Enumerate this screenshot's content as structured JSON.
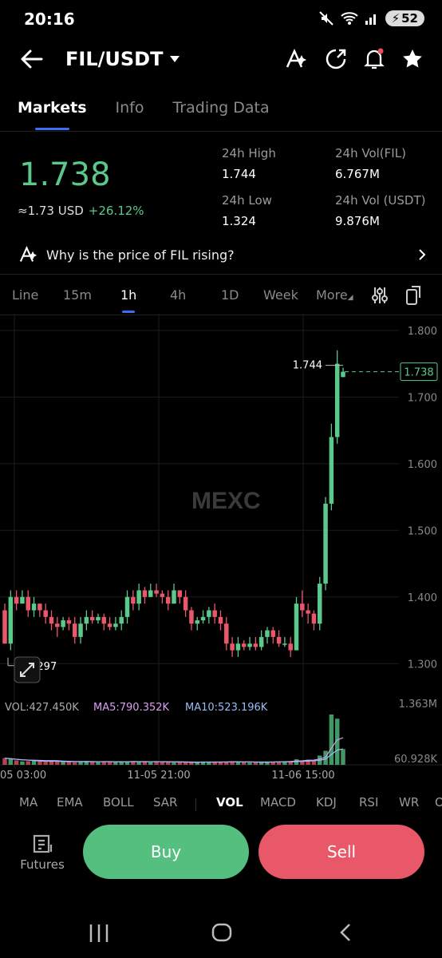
{
  "status": {
    "time": "20:16",
    "battery": "52"
  },
  "header": {
    "pair": "FIL/USDT"
  },
  "tabs": [
    {
      "label": "Markets",
      "active": true
    },
    {
      "label": "Info",
      "active": false
    },
    {
      "label": "Trading Data",
      "active": false
    }
  ],
  "price": {
    "last": "1.738",
    "usd": "≈1.73 USD",
    "change": "+26.12%",
    "stats": {
      "high_label": "24h High",
      "high": "1.744",
      "low_label": "24h Low",
      "low": "1.324",
      "vol_fil_label": "24h Vol(FIL)",
      "vol_fil": "6.767M",
      "vol_usdt_label": "24h Vol (USDT)",
      "vol_usdt": "9.876M"
    }
  },
  "why": {
    "text": "Why is the price of FIL rising?"
  },
  "intervals": [
    "Line",
    "15m",
    "1h",
    "4h",
    "1D",
    "Week",
    "More"
  ],
  "active_interval": "1h",
  "chart_data": {
    "type": "candlestick",
    "watermark": "MEXC",
    "y_ticks": [
      "1.800",
      "1.700",
      "1.600",
      "1.500",
      "1.400",
      "1.300"
    ],
    "ylim": [
      1.25,
      1.825
    ],
    "x_ticks": [
      "05 03:00",
      "11-05 21:00",
      "11-06 15:00"
    ],
    "last_price_tag": "1.738",
    "last_price": 1.738,
    "high_marker": "1.744",
    "high_value": 1.744,
    "low_marker": "1.297",
    "low_value": 1.297,
    "candles": [
      [
        1.38,
        1.33,
        1.39,
        1.33
      ],
      [
        1.33,
        1.4,
        1.41,
        1.32
      ],
      [
        1.4,
        1.39,
        1.41,
        1.38
      ],
      [
        1.39,
        1.4,
        1.41,
        1.39
      ],
      [
        1.4,
        1.38,
        1.41,
        1.37
      ],
      [
        1.38,
        1.39,
        1.4,
        1.37
      ],
      [
        1.39,
        1.38,
        1.39,
        1.37
      ],
      [
        1.38,
        1.37,
        1.39,
        1.36
      ],
      [
        1.37,
        1.36,
        1.38,
        1.35
      ],
      [
        1.36,
        1.355,
        1.37,
        1.34
      ],
      [
        1.355,
        1.365,
        1.37,
        1.35
      ],
      [
        1.365,
        1.36,
        1.37,
        1.35
      ],
      [
        1.36,
        1.34,
        1.37,
        1.33
      ],
      [
        1.34,
        1.36,
        1.37,
        1.33
      ],
      [
        1.36,
        1.37,
        1.38,
        1.35
      ],
      [
        1.37,
        1.365,
        1.38,
        1.36
      ],
      [
        1.365,
        1.37,
        1.375,
        1.36
      ],
      [
        1.37,
        1.36,
        1.375,
        1.35
      ],
      [
        1.36,
        1.355,
        1.37,
        1.35
      ],
      [
        1.355,
        1.36,
        1.37,
        1.35
      ],
      [
        1.36,
        1.37,
        1.38,
        1.35
      ],
      [
        1.37,
        1.4,
        1.41,
        1.36
      ],
      [
        1.4,
        1.39,
        1.41,
        1.38
      ],
      [
        1.39,
        1.41,
        1.42,
        1.38
      ],
      [
        1.41,
        1.4,
        1.415,
        1.39
      ],
      [
        1.4,
        1.41,
        1.42,
        1.4
      ],
      [
        1.41,
        1.405,
        1.42,
        1.4
      ],
      [
        1.405,
        1.4,
        1.41,
        1.39
      ],
      [
        1.4,
        1.39,
        1.41,
        1.38
      ],
      [
        1.39,
        1.41,
        1.42,
        1.39
      ],
      [
        1.41,
        1.4,
        1.41,
        1.39
      ],
      [
        1.4,
        1.38,
        1.41,
        1.37
      ],
      [
        1.38,
        1.36,
        1.385,
        1.35
      ],
      [
        1.36,
        1.365,
        1.37,
        1.35
      ],
      [
        1.365,
        1.37,
        1.38,
        1.36
      ],
      [
        1.37,
        1.38,
        1.385,
        1.36
      ],
      [
        1.38,
        1.37,
        1.39,
        1.36
      ],
      [
        1.37,
        1.36,
        1.38,
        1.35
      ],
      [
        1.36,
        1.33,
        1.37,
        1.32
      ],
      [
        1.33,
        1.32,
        1.34,
        1.31
      ],
      [
        1.32,
        1.33,
        1.34,
        1.31
      ],
      [
        1.33,
        1.325,
        1.335,
        1.32
      ],
      [
        1.325,
        1.33,
        1.34,
        1.32
      ],
      [
        1.33,
        1.325,
        1.34,
        1.32
      ],
      [
        1.325,
        1.34,
        1.35,
        1.32
      ],
      [
        1.34,
        1.35,
        1.355,
        1.33
      ],
      [
        1.35,
        1.34,
        1.355,
        1.33
      ],
      [
        1.34,
        1.33,
        1.35,
        1.325
      ],
      [
        1.33,
        1.33,
        1.34,
        1.325
      ],
      [
        1.33,
        1.32,
        1.34,
        1.31
      ],
      [
        1.32,
        1.39,
        1.4,
        1.32
      ],
      [
        1.39,
        1.38,
        1.41,
        1.37
      ],
      [
        1.38,
        1.375,
        1.39,
        1.36
      ],
      [
        1.375,
        1.36,
        1.38,
        1.35
      ],
      [
        1.36,
        1.42,
        1.43,
        1.35
      ],
      [
        1.42,
        1.54,
        1.55,
        1.41
      ],
      [
        1.54,
        1.64,
        1.66,
        1.53
      ],
      [
        1.64,
        1.75,
        1.77,
        1.63
      ],
      [
        1.73,
        1.738,
        1.744,
        1.73
      ]
    ],
    "volume": {
      "label": "VOL:427.450K",
      "ma5_label": "MA5:790.352K",
      "ma10_label": "MA10:523.196K",
      "max_label": "1.363M",
      "min_label": "60.928K",
      "max": 1363000,
      "values": [
        180,
        150,
        120,
        90,
        100,
        110,
        90,
        80,
        100,
        85,
        90,
        80,
        70,
        90,
        100,
        80,
        70,
        90,
        95,
        70,
        80,
        85,
        100,
        90,
        80,
        70,
        90,
        80,
        70,
        60,
        80,
        70,
        60,
        70,
        90,
        80,
        75,
        70,
        85,
        95,
        80,
        70,
        60,
        65,
        75,
        80,
        90,
        85,
        95,
        100,
        150,
        120,
        140,
        130,
        250,
        380,
        1363,
        1250,
        427
      ]
    }
  },
  "indicators": [
    "MA",
    "EMA",
    "BOLL",
    "SAR",
    "VOL",
    "MACD",
    "KDJ",
    "RSI",
    "WR",
    "OBV"
  ],
  "active_indicator": "VOL",
  "bottom": {
    "futures": "Futures",
    "buy": "Buy",
    "sell": "Sell"
  }
}
